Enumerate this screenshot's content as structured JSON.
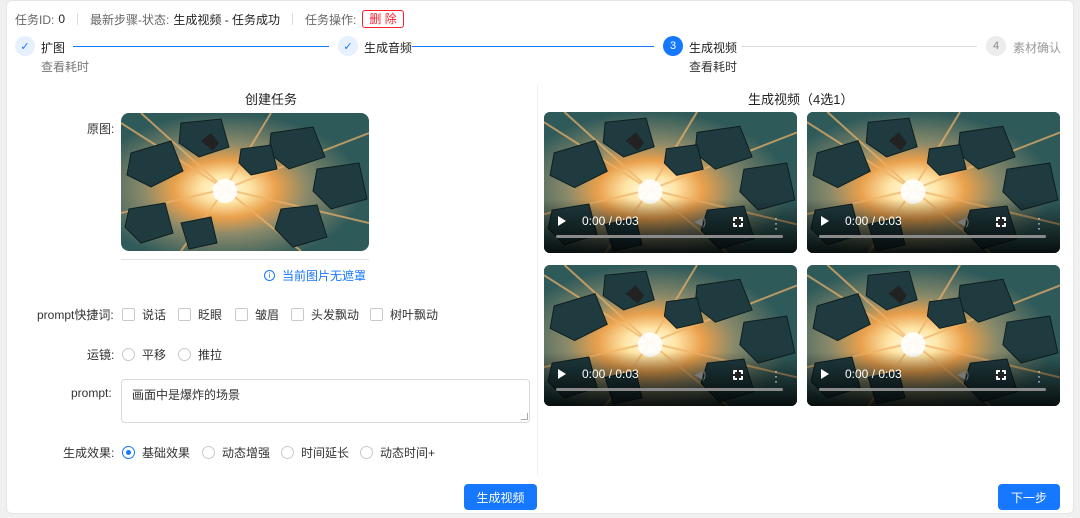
{
  "header": {
    "task_id_label": "任务ID:",
    "task_id_value": "0",
    "latest_label": "最新步骤-状态:",
    "latest_value": "生成视频 - 任务成功",
    "ops_label": "任务操作:",
    "delete_label": "删 除"
  },
  "steps": [
    {
      "title": "扩图",
      "sub": "查看耗时",
      "status": "done",
      "icon": "check-icon"
    },
    {
      "title": "生成音频",
      "sub": "",
      "status": "done",
      "icon": "check-icon"
    },
    {
      "title": "生成视频",
      "sub": "查看耗时",
      "status": "active",
      "num": "3"
    },
    {
      "title": "素材确认",
      "sub": "",
      "status": "wait",
      "num": "4"
    }
  ],
  "left": {
    "title": "创建任务",
    "image_label": "原图:",
    "notice": "当前图片无遮罩",
    "shortcut_label": "prompt快捷词:",
    "shortcuts": [
      "说话",
      "眨眼",
      "皱眉",
      "头发飘动",
      "树叶飘动"
    ],
    "camera_label": "运镜:",
    "camera_options": [
      "平移",
      "推拉"
    ],
    "prompt_label": "prompt:",
    "prompt_value": "画面中是爆炸的场景",
    "effect_label": "生成效果:",
    "effects": [
      "基础效果",
      "动态增强",
      "时间延长",
      "动态时间+"
    ],
    "effect_selected": "基础效果",
    "generate_button": "生成视频"
  },
  "right": {
    "title": "生成视频（4选1）",
    "videos": [
      {
        "time": "0:00 / 0:03"
      },
      {
        "time": "0:00 / 0:03"
      },
      {
        "time": "0:00 / 0:03"
      },
      {
        "time": "0:00 / 0:03"
      }
    ],
    "next_button": "下一步"
  },
  "colors": {
    "primary": "#1677ff",
    "danger": "#f5222d",
    "border": "#d9d9d9"
  }
}
